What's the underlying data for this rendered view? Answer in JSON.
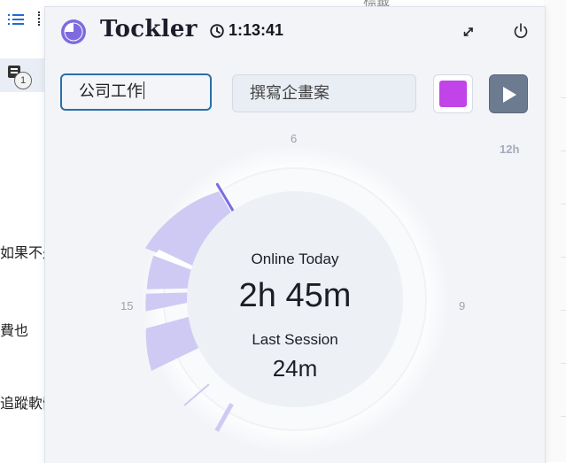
{
  "background_app": {
    "top_text": "標籤",
    "lines": [
      "如果不是",
      "費也",
      "追蹤軟體"
    ],
    "timer_badge": "1"
  },
  "header": {
    "app_name": "Tockler",
    "timer": "1:13:41",
    "icons": [
      "clock-icon",
      "expand-icon",
      "power-icon"
    ]
  },
  "tracking": {
    "task_value": "公司工作",
    "description_value": "撰寫企畫案",
    "color": "#c044e8",
    "play_icon": "play-icon"
  },
  "dial": {
    "labels": {
      "top": "6",
      "right": "9",
      "left": "15",
      "top_right": "12h"
    },
    "online_label": "Online Today",
    "online_value": "2h 45m",
    "session_label": "Last Session",
    "session_value": "24m",
    "accent_color": "#7f6ae0",
    "segment_color": "#cfcaf3"
  }
}
